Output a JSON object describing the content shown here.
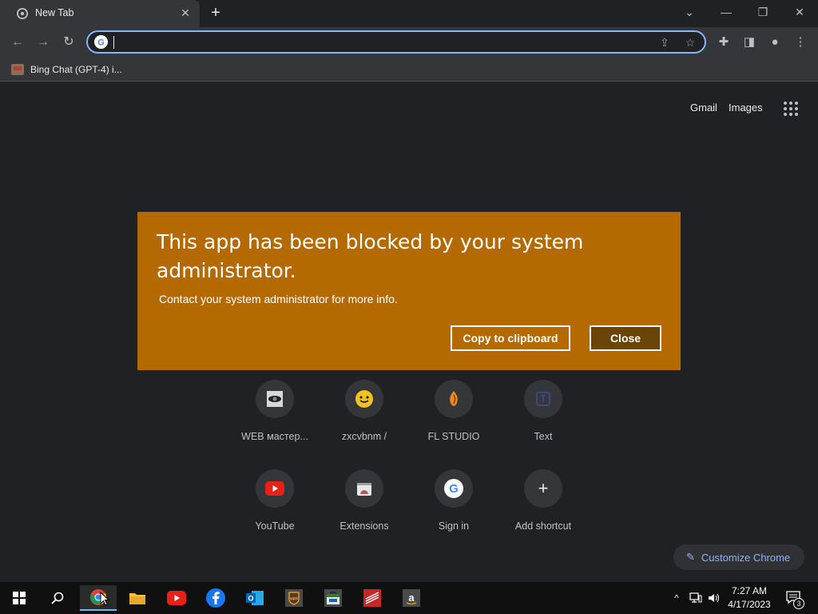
{
  "browser": {
    "tab_title": "New Tab",
    "tab_close": "✕",
    "new_tab": "+",
    "omnibox_value": "",
    "bookmark_label": "Bing Chat (GPT-4) i..."
  },
  "page": {
    "gmail": "Gmail",
    "images": "Images",
    "shortcuts": [
      {
        "label": "WEB мастер..."
      },
      {
        "label": "zxcvbnm /"
      },
      {
        "label": "FL STUDIO"
      },
      {
        "label": "Text"
      },
      {
        "label": "YouTube"
      },
      {
        "label": "Extensions"
      },
      {
        "label": "Sign in"
      },
      {
        "label": "Add shortcut"
      }
    ],
    "customize": "Customize Chrome"
  },
  "dialog": {
    "heading": "This app has been blocked by your system administrator.",
    "message": "Contact your system administrator for more info.",
    "copy_button": "Copy to clipboard",
    "close_button": "Close",
    "background_color": "#b46a00"
  },
  "taskbar": {
    "time": "7:27 AM",
    "date": "4/17/2023",
    "notification_count": "3"
  },
  "colors": {
    "accent": "#8ab4f8",
    "page_bg": "#202124",
    "toolbar_bg": "#35363a"
  }
}
